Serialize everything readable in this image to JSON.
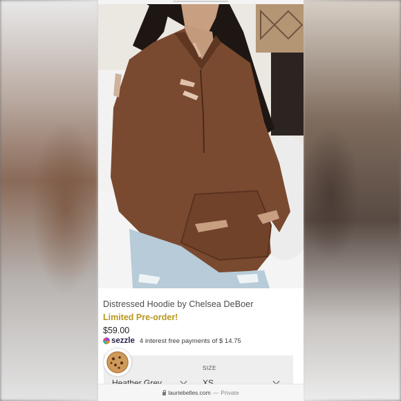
{
  "product": {
    "title": "Distressed Hoodie by Chelsea DeBoer",
    "badge": "Limited Pre-order!",
    "price": "$59.00",
    "sezzle": {
      "brand": "sezzle",
      "text": "4 interest free payments of $ 14.75"
    }
  },
  "variants": {
    "color_value": "Heather Grey",
    "size_label": "SIZE",
    "size_value": "XS"
  },
  "browser": {
    "url": "lauriebelles.com",
    "separator": "—",
    "mode": "Private"
  },
  "icons": {
    "avatar": "cookie-avatar-icon",
    "lock": "lock-icon",
    "chevron": "chevron-down-icon",
    "sezzle": "sezzle-logo-icon"
  },
  "colors": {
    "badge": "#b8971e",
    "hoodie": "#7a4a30",
    "variant_bg": "#eeeeee"
  }
}
